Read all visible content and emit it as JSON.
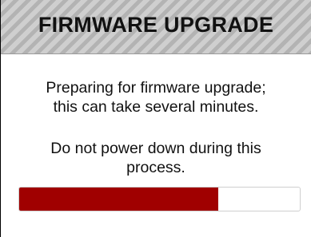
{
  "header": {
    "title": "FIRMWARE UPGRADE"
  },
  "message": {
    "line1": "Preparing for firmware upgrade;",
    "line2": "this can take several minutes.",
    "line3": "Do not power down during this",
    "line4": "process."
  },
  "progress": {
    "fraction": 0.71,
    "fill_color": "#a00000"
  }
}
